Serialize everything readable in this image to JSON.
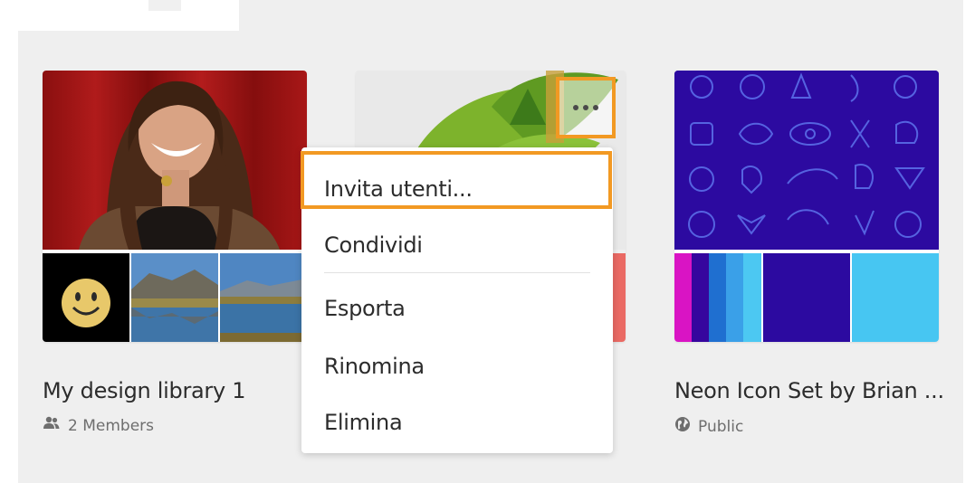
{
  "libraries": [
    {
      "title": "My design library 1",
      "meta": "2 Members",
      "meta_icon": "members-icon"
    },
    {
      "title": "",
      "meta": ""
    },
    {
      "title": "Neon Icon Set by Brian ...",
      "meta": "Public",
      "meta_icon": "globe-icon"
    }
  ],
  "more_button": {
    "icon": "more-horizontal-icon"
  },
  "context_menu": {
    "items": [
      {
        "label": "Invita utenti..."
      },
      {
        "label": "Condividi"
      },
      {
        "label": "Esporta"
      },
      {
        "label": "Rinomina"
      },
      {
        "label": "Elimina"
      }
    ]
  },
  "colors": {
    "highlight": "#f29923",
    "panel_background": "#efefef",
    "neon_background": "#2c0aa0",
    "neon_swatches": [
      "#d914c4",
      "#36069e",
      "#1f6fd0",
      "#3aa0e8",
      "#4cc8f2",
      "#2c0aa0",
      "#47c6f2"
    ]
  }
}
